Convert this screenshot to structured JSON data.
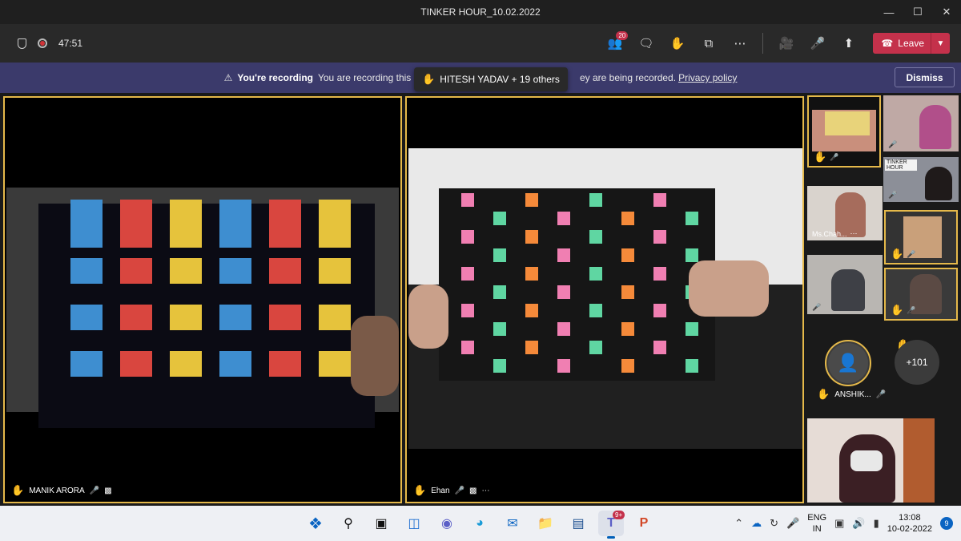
{
  "window": {
    "title": "TINKER HOUR_10.02.2022"
  },
  "toolbar": {
    "timer": "47:51",
    "participants_badge": "20",
    "leave_label": "Leave"
  },
  "banner": {
    "title": "You're recording",
    "message_start": "You are recording this meeting. B",
    "message_end": "ey are being recorded.",
    "privacy_link": "Privacy policy",
    "dismiss_label": "Dismiss"
  },
  "raised_hands_popup": {
    "text": "HITESH YADAV + 19 others"
  },
  "main_tiles": [
    {
      "name": "MANIK ARORA"
    },
    {
      "name": "Ehan"
    }
  ],
  "side_tiles": {
    "named": "Ms.Chah...",
    "avatar_name": "ANSHIK...",
    "overflow_count": "+101",
    "tinker_sign": "TINKER HOUR"
  },
  "taskbar": {
    "teams_badge": "9+",
    "language": [
      "ENG",
      "IN"
    ],
    "time": "13:08",
    "date": "10-02-2022",
    "notifications": "9"
  }
}
